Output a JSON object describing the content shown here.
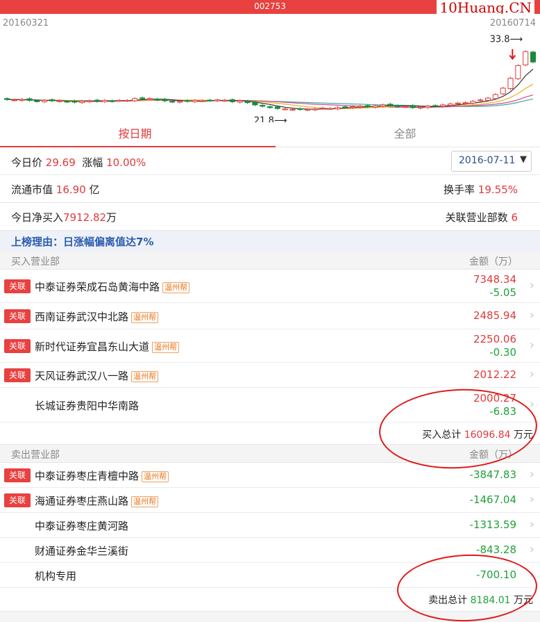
{
  "header": {
    "stock_code": "002753",
    "brand_watermark": "10Huang.CN"
  },
  "chart": {
    "date_start": "20160321",
    "date_end": "20160714",
    "high_label": "33.8⟶",
    "low_label": "21.8⟶",
    "colors": {
      "up": "#e03a3a",
      "down": "#1a8a3a",
      "ma5": "#333333",
      "ma10": "#e8b020",
      "ma20": "#d04a9a",
      "ma30": "#3aaa9a"
    },
    "closes": [
      21.4,
      21.3,
      21.4,
      21.2,
      21.0,
      21.2,
      21.1,
      21.1,
      20.9,
      20.8,
      21.0,
      21.1,
      21.0,
      21.2,
      21.0,
      21.2,
      21.2,
      21.6,
      21.7,
      21.6,
      21.3,
      21.1,
      20.9,
      21.0,
      21.0,
      21.2,
      21.1,
      21.2,
      21.3,
      21.2,
      20.9,
      21.1,
      20.7,
      20.2,
      19.9,
      19.6,
      19.4,
      19.3,
      19.2,
      19.2,
      19.2,
      19.3,
      19.5,
      19.4,
      19.6,
      19.7,
      19.8,
      19.9,
      19.8,
      20.0,
      20.2,
      20.1,
      19.9,
      19.9,
      19.6,
      19.7,
      19.9,
      20.0,
      20.2,
      20.4,
      20.6,
      20.7,
      21.0,
      21.3,
      21.7,
      22.5,
      23.9,
      26.1,
      28.9,
      32.0,
      29.7
    ]
  },
  "tabs": [
    {
      "label": "按日期",
      "active": true
    },
    {
      "label": "全部",
      "active": false
    }
  ],
  "summary": {
    "price_label": "今日价",
    "price": "29.69",
    "change_label": "涨幅",
    "change": "10.00%",
    "date": "2016-07-11",
    "mktcap_label": "流通市值",
    "mktcap": "16.90",
    "mktcap_unit": "亿",
    "turnover_label": "换手率",
    "turnover": "19.55%",
    "netbuy_label": "今日净买入",
    "netbuy": "7912.82",
    "netbuy_unit": "万",
    "linked_label": "关联营业部数",
    "linked": "6"
  },
  "reason": "上榜理由：日涨幅偏离值达7%",
  "buy": {
    "header": "买入营业部",
    "amount_header": "金额（万）",
    "rows": [
      {
        "badge": "关联",
        "name": "中泰证券荣成石岛黄海中路",
        "tag": "温州帮",
        "amount": "7348.34",
        "sub": "-5.05"
      },
      {
        "badge": "关联",
        "name": "西南证券武汉中北路",
        "tag": "温州帮",
        "amount": "2485.94",
        "sub": ""
      },
      {
        "badge": "关联",
        "name": "新时代证券宜昌东山大道",
        "tag": "温州帮",
        "amount": "2250.06",
        "sub": "-0.30"
      },
      {
        "badge": "关联",
        "name": "天风证券武汉八一路",
        "tag": "温州帮",
        "amount": "2012.22",
        "sub": ""
      },
      {
        "badge": "",
        "name": "长城证券贵阳中华南路",
        "tag": "",
        "amount": "2000.27",
        "sub": "-6.83"
      }
    ],
    "total_label": "买入总计",
    "total": "16096.84",
    "total_unit": "万元"
  },
  "sell": {
    "header": "卖出营业部",
    "amount_header": "金额（万）",
    "rows": [
      {
        "badge": "关联",
        "name": "中泰证券枣庄青檀中路",
        "tag": "温州帮",
        "amount": "-3847.83"
      },
      {
        "badge": "关联",
        "name": "海通证券枣庄燕山路",
        "tag": "温州帮",
        "amount": "-1467.04"
      },
      {
        "badge": "",
        "name": "中泰证券枣庄黄河路",
        "tag": "",
        "amount": "-1313.59"
      },
      {
        "badge": "",
        "name": "财通证券金华兰溪街",
        "tag": "",
        "amount": "-843.28"
      },
      {
        "badge": "",
        "name": "机构专用",
        "tag": "",
        "amount": "-700.10"
      }
    ],
    "total_label": "卖出总计",
    "total": "8184.01",
    "total_unit": "万元"
  }
}
